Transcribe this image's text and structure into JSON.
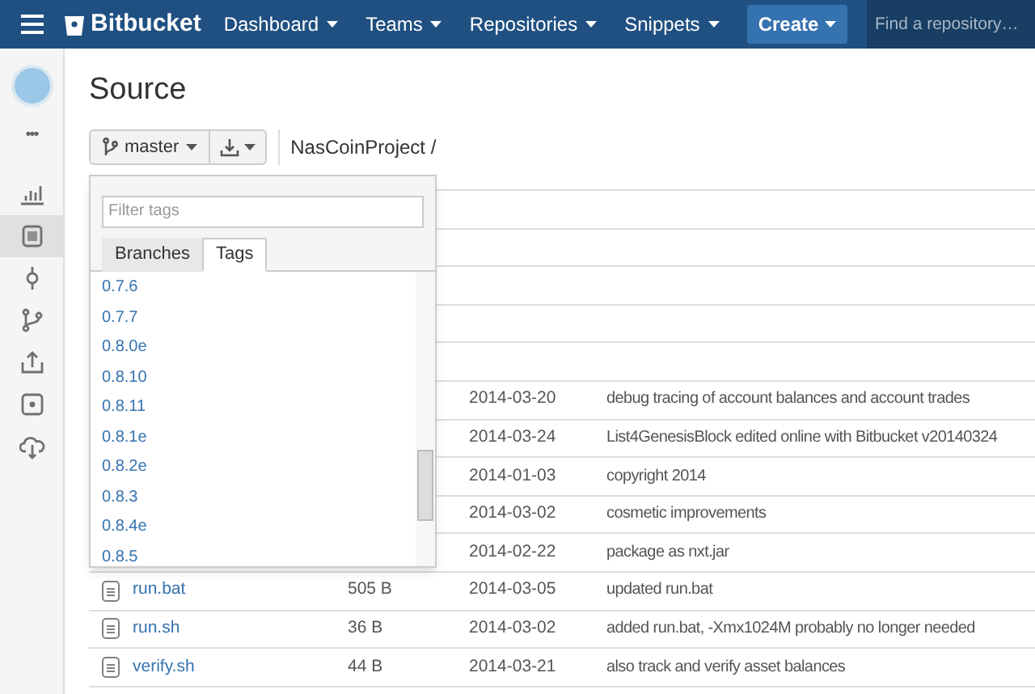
{
  "header": {
    "brand": "Bitbucket",
    "nav": [
      {
        "label": "Dashboard"
      },
      {
        "label": "Teams"
      },
      {
        "label": "Repositories"
      },
      {
        "label": "Snippets"
      }
    ],
    "create": "Create",
    "search": {
      "placeholder": "Find a repository…"
    }
  },
  "sidebar": {
    "more": "•••",
    "items": [
      {
        "kind": "overview",
        "selected": false
      },
      {
        "kind": "source",
        "selected": true
      },
      {
        "kind": "commits",
        "selected": false
      },
      {
        "kind": "branches",
        "selected": false
      },
      {
        "kind": "pull",
        "selected": false
      },
      {
        "kind": "issues",
        "selected": false
      },
      {
        "kind": "downloads",
        "selected": false
      }
    ]
  },
  "title": "Source",
  "toolbar": {
    "branch": "master",
    "path": "NasCoinProject /"
  },
  "dropdown": {
    "filter": {
      "placeholder": "Filter tags"
    },
    "tabs": [
      {
        "label": "Branches",
        "selected": false
      },
      {
        "label": "Tags",
        "selected": true
      }
    ],
    "tags": [
      "0.7.6",
      "0.7.7",
      "0.8.0e",
      "0.8.10",
      "0.8.11",
      "0.8.1e",
      "0.8.2e",
      "0.8.3",
      "0.8.4e",
      "0.8.5"
    ]
  },
  "rows": [
    {},
    {},
    {},
    {},
    {},
    {
      "date": "2014-03-20",
      "message": "debug tracing of account balances and account trades"
    },
    {
      "date": "2014-03-24",
      "message": "List4GenesisBlock edited online with Bitbucket v20140324"
    },
    {
      "date": "2014-01-03",
      "message": "copyright 2014"
    },
    {
      "date": "2014-03-02",
      "message": "cosmetic improvements"
    },
    {
      "date": "2014-02-22",
      "message": "package as nxt.jar"
    },
    {
      "name": "run.bat",
      "size": "505 B",
      "date": "2014-03-05",
      "message": "updated run.bat"
    },
    {
      "name": "run.sh",
      "size": "36 B",
      "date": "2014-03-02",
      "message": "added run.bat, -Xmx1024M probably no longer needed"
    },
    {
      "name": "verify.sh",
      "size": "44 B",
      "date": "2014-03-21",
      "message": "also track and verify asset balances"
    }
  ]
}
